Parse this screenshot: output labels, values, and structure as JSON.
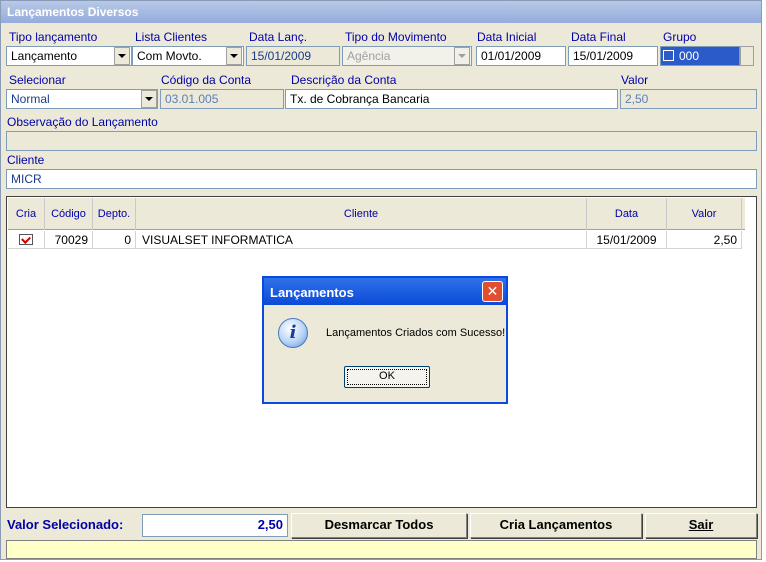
{
  "window": {
    "title": "Lançamentos Diversos"
  },
  "labels": {
    "tipo_lancamento": "Tipo lançamento",
    "lista_clientes": "Lista Clientes",
    "data_lanc": "Data Lanç.",
    "tipo_movimento": "Tipo do Movimento",
    "data_inicial": "Data Inicial",
    "data_final": "Data Final",
    "grupo": "Grupo",
    "selecionar": "Selecionar",
    "codigo_conta": "Código da Conta",
    "descricao_conta": "Descrição da Conta",
    "valor": "Valor",
    "observacao": "Observação do Lançamento",
    "cliente": "Cliente"
  },
  "fields": {
    "tipo_lancamento": "Lançamento",
    "lista_clientes": "Com Movto.",
    "data_lanc": "15/01/2009",
    "tipo_movimento": "Agência",
    "data_inicial": "01/01/2009",
    "data_final": "15/01/2009",
    "grupo": "000",
    "selecionar": "Normal",
    "codigo_conta": "03.01.005",
    "descricao_conta": "Tx. de Cobrança Bancaria",
    "valor": "2,50",
    "observacao": "",
    "cliente": "MICR"
  },
  "grid": {
    "headers": {
      "cria": "Cria",
      "codigo": "Código",
      "depto": "Depto.",
      "cliente": "Cliente",
      "data": "Data",
      "valor": "Valor"
    },
    "rows": [
      {
        "cria": true,
        "codigo": "70029",
        "depto": "0",
        "cliente": "VISUALSET INFORMATICA",
        "data": "15/01/2009",
        "valor": "2,50"
      }
    ]
  },
  "dialog": {
    "title": "Lançamentos",
    "message": "Lançamentos Criados com Sucesso!",
    "ok": "OK",
    "close": "✕"
  },
  "bottom": {
    "valor_selecionado_label": "Valor Selecionado:",
    "valor_selecionado": "2,50",
    "desmarcar": "Desmarcar Todos",
    "cria": "Cria Lançamentos",
    "sair": "Sair"
  }
}
